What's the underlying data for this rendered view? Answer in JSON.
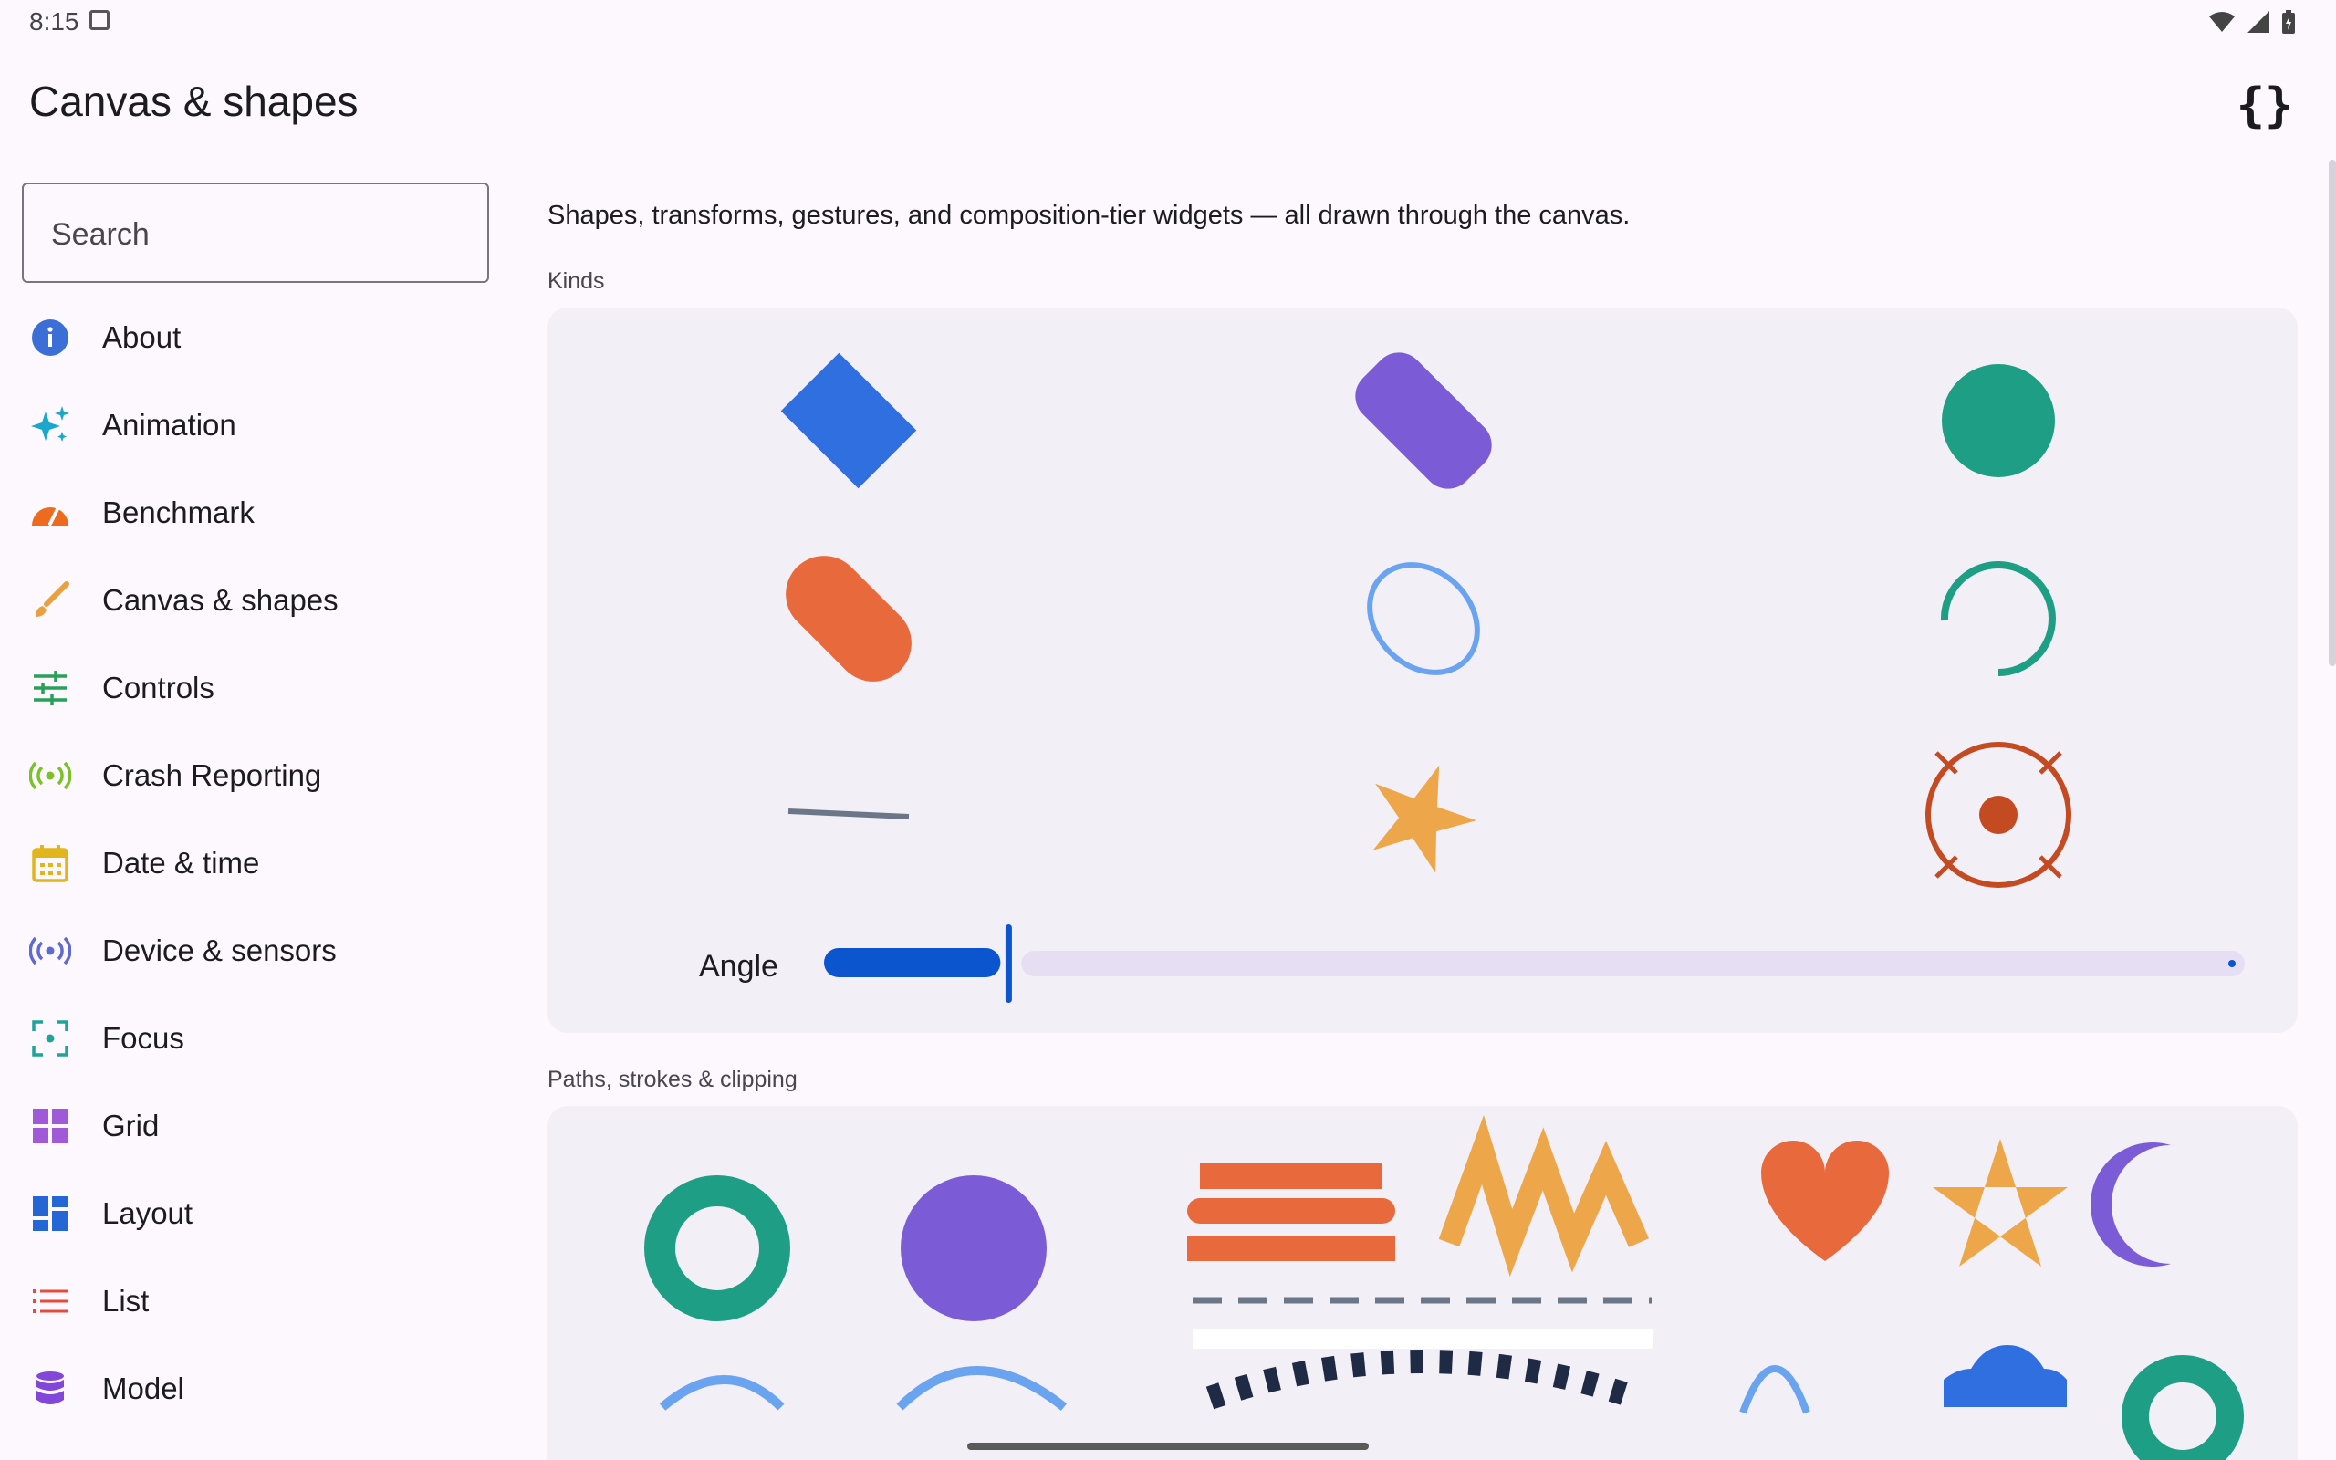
{
  "status": {
    "time": "8:15"
  },
  "app": {
    "title": "Canvas & shapes"
  },
  "search": {
    "placeholder": "Search"
  },
  "nav": {
    "items": [
      {
        "label": "About",
        "icon": "info-icon",
        "color": "#3b6fd6"
      },
      {
        "label": "Animation",
        "icon": "sparkle-icon",
        "color": "#1aa7c9"
      },
      {
        "label": "Benchmark",
        "icon": "speedometer-icon",
        "color": "#ee6a1e"
      },
      {
        "label": "Canvas & shapes",
        "icon": "brush-icon",
        "color": "#e9a03f"
      },
      {
        "label": "Controls",
        "icon": "sliders-icon",
        "color": "#27a05a"
      },
      {
        "label": "Crash Reporting",
        "icon": "broadcast-icon",
        "color": "#7cc12a"
      },
      {
        "label": "Date & time",
        "icon": "calendar-icon",
        "color": "#e2b51d"
      },
      {
        "label": "Device & sensors",
        "icon": "sensors-icon",
        "color": "#5e6ad2"
      },
      {
        "label": "Focus",
        "icon": "focus-icon",
        "color": "#1fa39a"
      },
      {
        "label": "Grid",
        "icon": "grid-icon",
        "color": "#a05ad8"
      },
      {
        "label": "Layout",
        "icon": "dashboard-icon",
        "color": "#2466d6"
      },
      {
        "label": "List",
        "icon": "list-icon",
        "color": "#e64a3c"
      },
      {
        "label": "Model",
        "icon": "database-icon",
        "color": "#8246d8"
      }
    ]
  },
  "content": {
    "description": "Shapes, transforms, gestures, and composition-tier widgets — all drawn through the canvas.",
    "kinds_label": "Kinds",
    "angle_label": "Angle",
    "angle_value": 0.13,
    "paths_label": "Paths, strokes & clipping"
  },
  "colors": {
    "blue": "#2f6fe0",
    "purple": "#7c5cd6",
    "teal": "#1f9e86",
    "orange": "#e8693c",
    "light_blue": "#6aa3f0",
    "amber": "#eda74a",
    "rust": "#c44a22",
    "slate": "#6b7789",
    "slider_active": "#0b55cf",
    "slider_track": "#e6dff4"
  }
}
